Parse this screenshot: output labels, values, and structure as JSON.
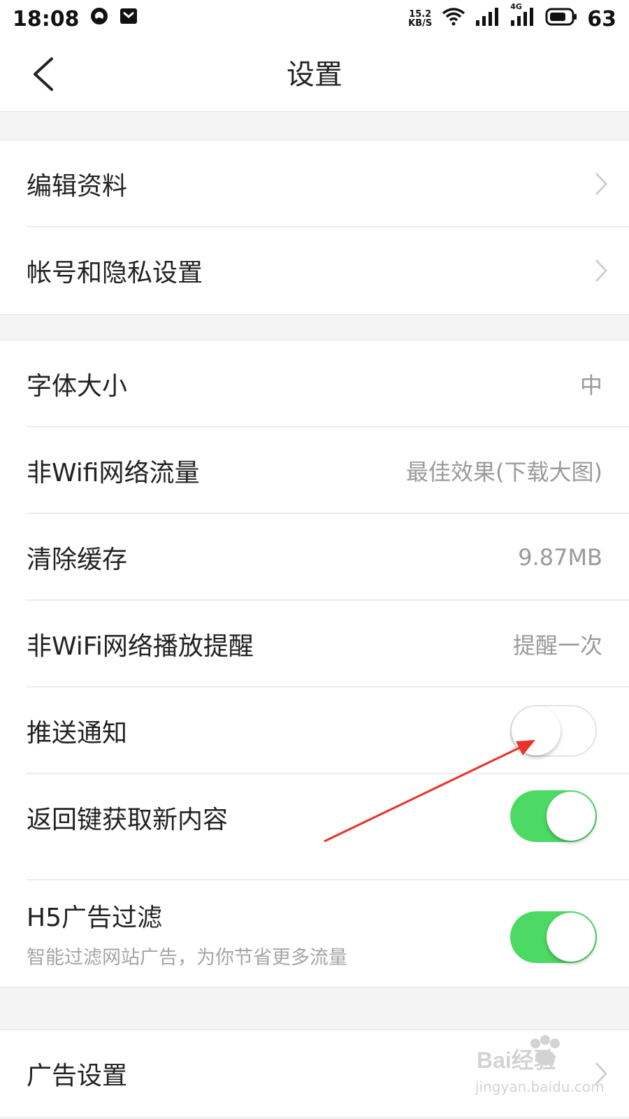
{
  "status_bar": {
    "time": "18:08",
    "net_speed_value": "15.2",
    "net_speed_unit": "KB/S",
    "network_type": "4G",
    "battery": "63"
  },
  "nav": {
    "title": "设置"
  },
  "groups": {
    "account": [
      {
        "label": "编辑资料"
      },
      {
        "label": "帐号和隐私设置"
      }
    ],
    "general": {
      "font_size": {
        "label": "字体大小",
        "value": "中"
      },
      "non_wifi_traffic": {
        "label": "非Wifi网络流量",
        "value": "最佳效果(下载大图)"
      },
      "clear_cache": {
        "label": "清除缓存",
        "value": "9.87MB"
      },
      "non_wifi_play_reminder": {
        "label": "非WiFi网络播放提醒",
        "value": "提醒一次"
      },
      "push_notification": {
        "label": "推送通知",
        "enabled": false
      },
      "back_key_refresh": {
        "label": "返回键获取新内容",
        "enabled": true
      },
      "h5_ad_filter": {
        "label": "H5广告过滤",
        "subtitle": "智能过滤网站广告，为你节省更多流量",
        "enabled": true
      }
    },
    "ads": [
      {
        "label": "广告设置"
      }
    ]
  },
  "colors": {
    "toggle_on": "#4cd964",
    "annotation_arrow": "#e8332a"
  },
  "watermark": {
    "brand": "Bai经验",
    "url": "jingyan.baidu.com"
  }
}
